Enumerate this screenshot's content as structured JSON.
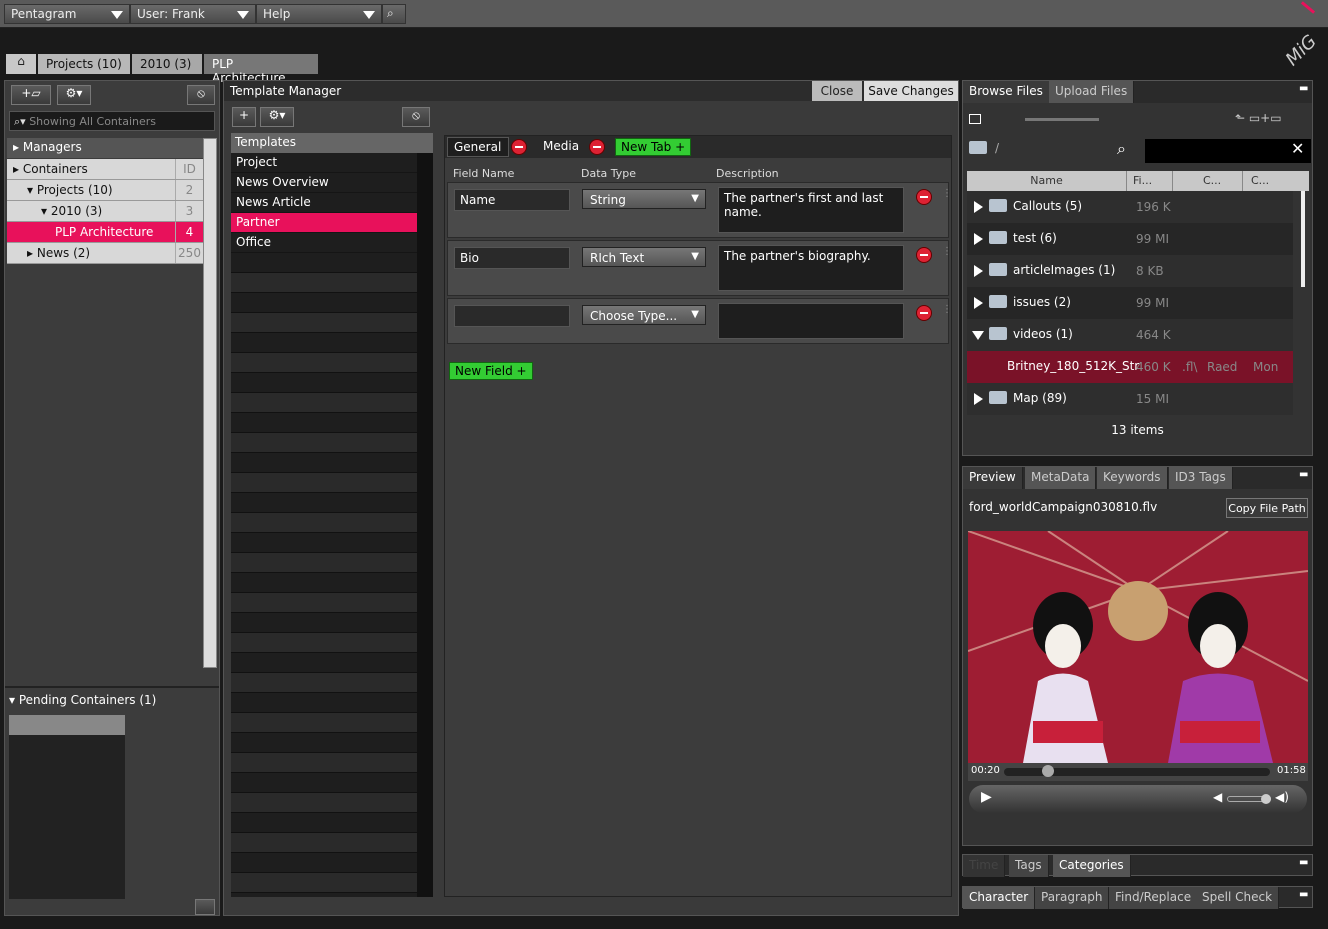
{
  "topbar": {
    "app": "Pentagram",
    "user": "User: Frank",
    "help": "Help"
  },
  "breadcrumb": [
    "Projects (10)",
    "2010 (3)",
    "PLP Architecture"
  ],
  "left": {
    "search_placeholder": "Showing All Containers",
    "managers_label": "Managers",
    "tree": [
      {
        "label": "Containers",
        "id": "ID",
        "indent": 0
      },
      {
        "label": "Projects (10)",
        "id": "2",
        "indent": 1
      },
      {
        "label": "2010 (3)",
        "id": "3",
        "indent": 2
      },
      {
        "label": "PLP Architecture",
        "id": "4",
        "indent": 3,
        "selected": true
      },
      {
        "label": "News (2)",
        "id": "250",
        "indent": 1
      }
    ],
    "pending_label": "Pending Containers (1)"
  },
  "template_manager": {
    "title": "Template Manager",
    "close_label": "Close",
    "save_label": "Save Changes",
    "templates_header": "Templates",
    "templates": [
      "Project",
      "News Overview",
      "News Article",
      "Partner",
      "Office"
    ],
    "selected_template": "Partner",
    "tabs": [
      "General",
      "Media"
    ],
    "new_tab_label": "New Tab +",
    "col_field_name": "Field Name",
    "col_data_type": "Data Type",
    "col_description": "Description",
    "fields": [
      {
        "name": "Name",
        "type": "String",
        "description": "The partner's first and last name."
      },
      {
        "name": "Bio",
        "type": "RIch Text",
        "description": "The partner's biography."
      },
      {
        "name": "",
        "type": "Choose Type...",
        "description": ""
      }
    ],
    "new_field_label": "New Field +"
  },
  "browser": {
    "tab_browse": "Browse Files",
    "tab_upload": "Upload Files",
    "path": "/",
    "cols": [
      "Name",
      "Fi...",
      "C...",
      "C..."
    ],
    "rows": [
      {
        "name": "Callouts (5)",
        "size": "196 K"
      },
      {
        "name": "test (6)",
        "size": "99 MI"
      },
      {
        "name": "articleImages (1)",
        "size": "8 KB"
      },
      {
        "name": "issues (2)",
        "size": "99 MI"
      },
      {
        "name": "videos (1)",
        "size": "464 K",
        "open": true
      },
      {
        "name": "Britney_180_512K_Str",
        "size": "460 K",
        "ext": ".fl\\",
        "user": "Raed",
        "day": "Mon",
        "file": true
      },
      {
        "name": "Map (89)",
        "size": "15 MI"
      }
    ],
    "count": "13 items"
  },
  "preview": {
    "tabs": [
      "Preview",
      "MetaData",
      "Keywords",
      "ID3 Tags"
    ],
    "filename": "ford_worldCampaign030810.flv",
    "copy_label": "Copy File Path",
    "time_current": "00:20",
    "time_total": "01:58",
    "progress": 0.04
  },
  "bottom_tabs1": [
    "Time",
    "Tags",
    "Categories"
  ],
  "bottom_tabs2": [
    "Character",
    "Paragraph",
    "Find/Replace",
    "Spell Check"
  ],
  "colors": {
    "accent": "#e8115b",
    "green": "#33cc33",
    "red": "#dd2233"
  }
}
